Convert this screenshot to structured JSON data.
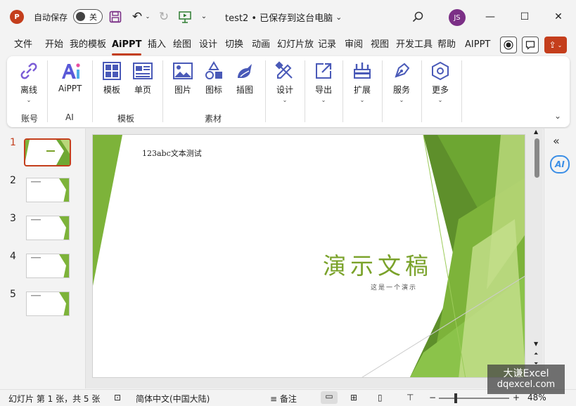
{
  "titlebar": {
    "app_logo_text": "P",
    "autosave_label": "自动保存",
    "autosave_state": "关",
    "doc_title": "test2 • 已保存到这台电脑",
    "avatar_initials": "JS"
  },
  "tabs": [
    "文件",
    "开始",
    "我的模板",
    "AiPPT",
    "插入",
    "绘图",
    "设计",
    "切换",
    "动画",
    "幻灯片放",
    "记录",
    "审阅",
    "视图",
    "开发工具",
    "帮助",
    "AIPPT"
  ],
  "active_tab": "AiPPT",
  "ribbon": {
    "buttons": [
      {
        "label": "离线",
        "icon": "link-icon"
      },
      {
        "label": "AiPPT",
        "icon": "ai-logo-icon"
      },
      {
        "label": "模板",
        "icon": "template-icon"
      },
      {
        "label": "单页",
        "icon": "single-page-icon"
      },
      {
        "label": "图片",
        "icon": "picture-icon"
      },
      {
        "label": "图标",
        "icon": "shapes-icon"
      },
      {
        "label": "插图",
        "icon": "illustration-icon"
      },
      {
        "label": "设计",
        "icon": "design-tools-icon"
      },
      {
        "label": "导出",
        "icon": "export-icon"
      },
      {
        "label": "扩展",
        "icon": "extension-icon"
      },
      {
        "label": "服务",
        "icon": "pen-nib-icon"
      },
      {
        "label": "更多",
        "icon": "hexagon-icon"
      }
    ],
    "groups": [
      "账号",
      "AI",
      "模板",
      "素材"
    ]
  },
  "slides": {
    "numbers": [
      "1",
      "2",
      "3",
      "4",
      "5"
    ],
    "current": 1
  },
  "slide_content": {
    "top_text": "123abc文本测试",
    "title": "演示文稿",
    "subtitle": "这是一个演示"
  },
  "statusbar": {
    "slide_info": "幻灯片 第 1 张，共 5 张",
    "language": "简体中文(中国大陆)",
    "notes": "备注",
    "zoom_minus": "−",
    "zoom_plus": "+",
    "zoom": "48%"
  },
  "watermark": {
    "line1": "大谦Excel",
    "line2": "dqexcel.com"
  },
  "colors": {
    "accent": "#c43e1c",
    "green_dark": "#5e8f2b",
    "green": "#7db33a",
    "green_light": "#b9d77a"
  }
}
